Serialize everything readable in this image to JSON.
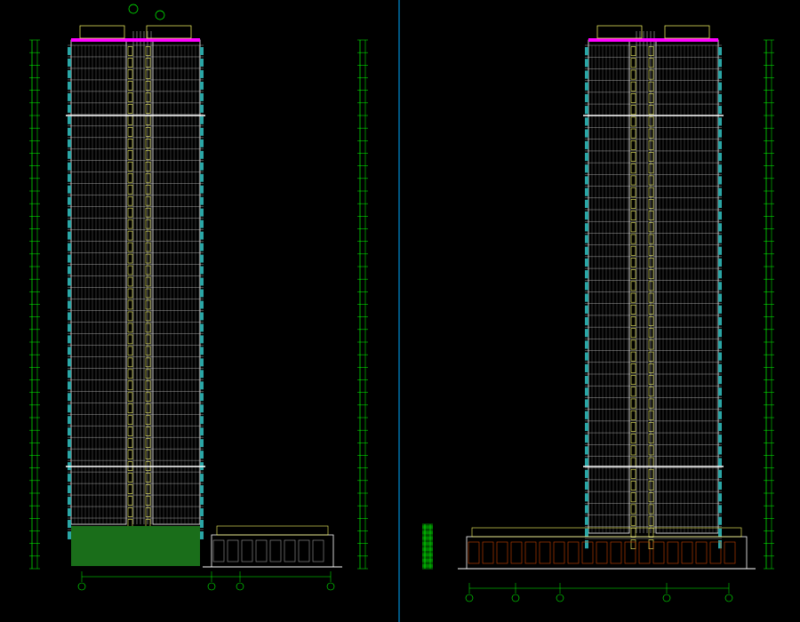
{
  "drawings": [
    {
      "caption": "",
      "scale": ""
    },
    {
      "caption": "",
      "scale": ""
    }
  ],
  "colors": {
    "background": "#000000",
    "outline": "#ffffff",
    "floor_line": "#c8c8c8",
    "window_blue": "#2aa6a6",
    "dimension": "#00ff00",
    "balcony": "#ffff66",
    "roof_magenta": "#ff00ff",
    "podium_green": "#1a6e1a",
    "storefront": "#cc4400",
    "separator": "#00aaff"
  }
}
